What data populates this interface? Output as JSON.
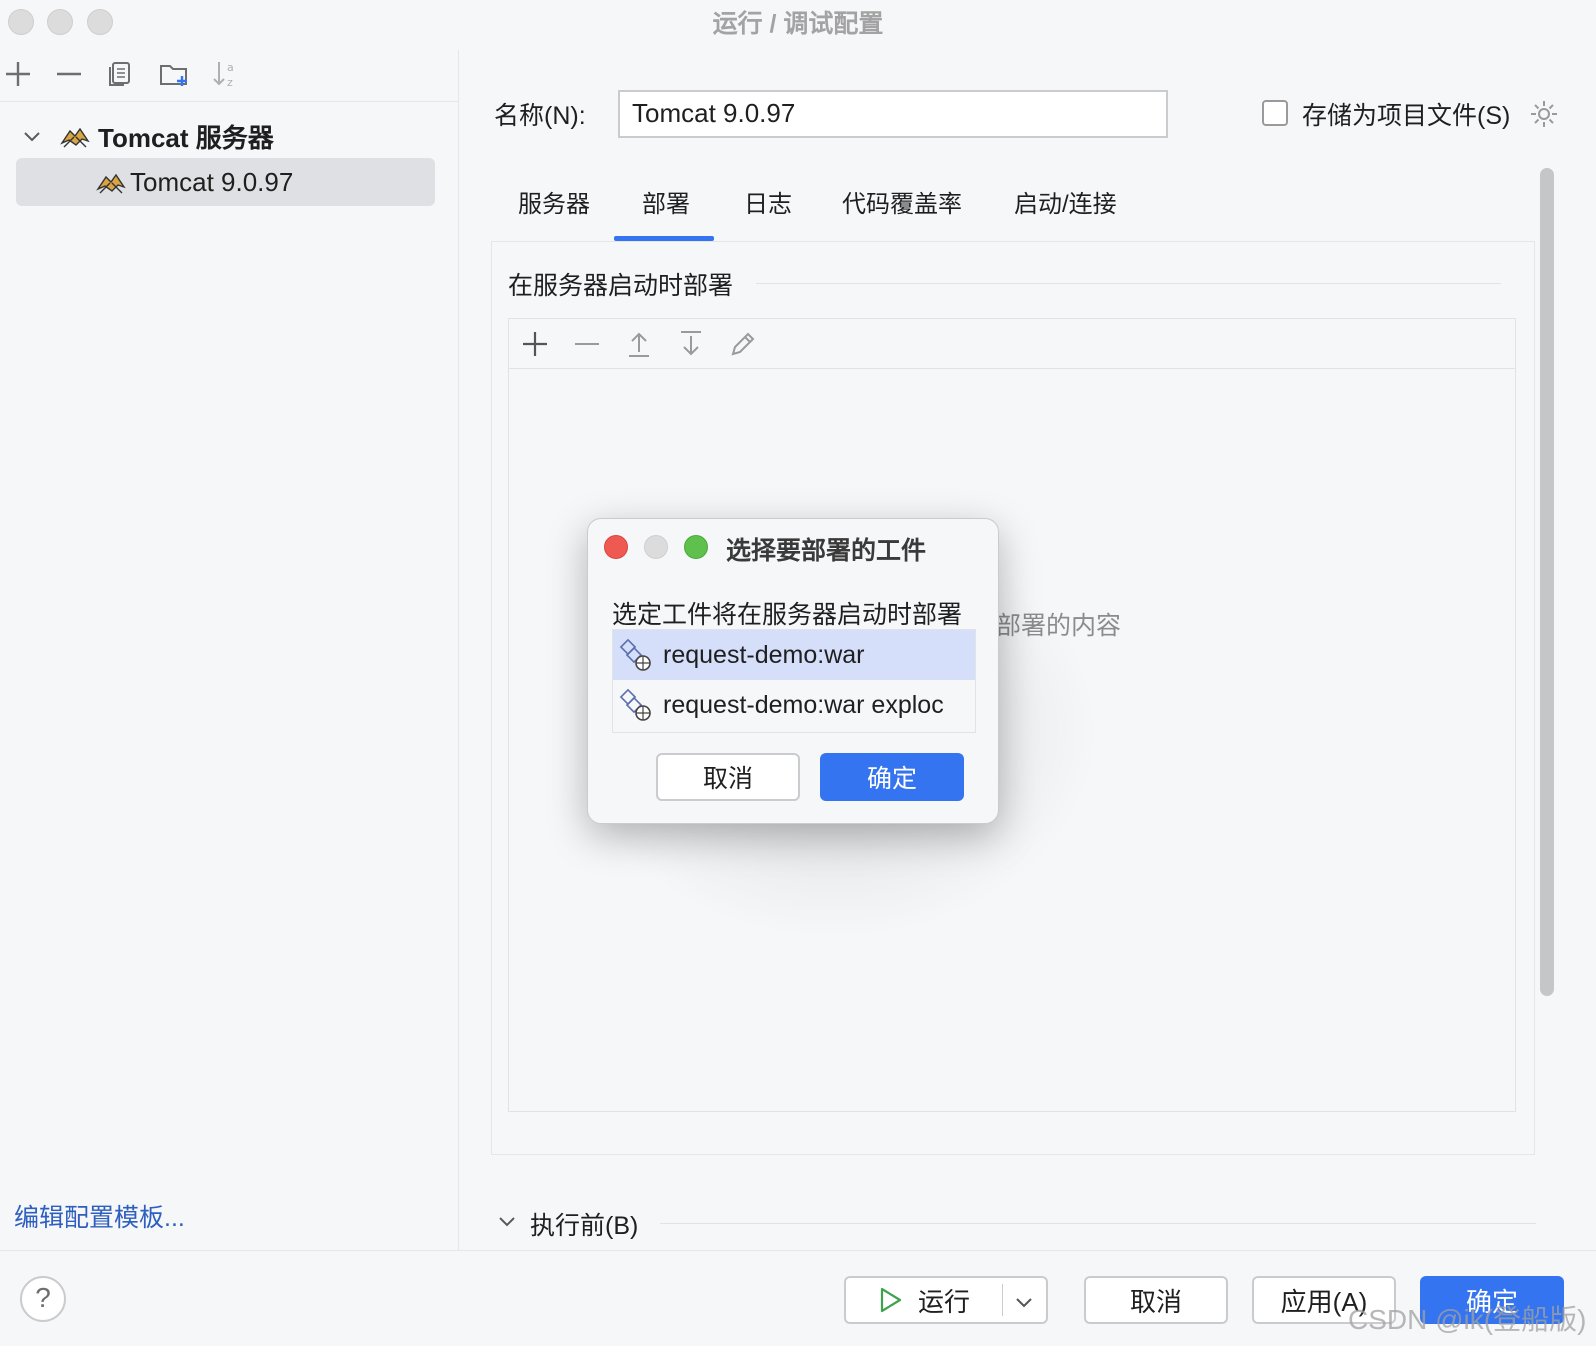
{
  "window": {
    "title": "运行 / 调试配置"
  },
  "left_pane": {
    "group_label": "Tomcat 服务器",
    "item_label": "Tomcat 9.0.97",
    "edit_templates_link": "编辑配置模板..."
  },
  "form": {
    "name_label": "名称(N):",
    "name_value": "Tomcat 9.0.97",
    "store_as_project_label": "存储为项目文件(S)",
    "store_as_project_checked": false
  },
  "tabs": [
    {
      "label": "服务器",
      "active": false
    },
    {
      "label": "部署",
      "active": true
    },
    {
      "label": "日志",
      "active": false
    },
    {
      "label": "代码覆盖率",
      "active": false
    },
    {
      "label": "启动/连接",
      "active": false
    }
  ],
  "deploy": {
    "section_title": "在服务器启动时部署",
    "empty_text_fragment": "部署的内容"
  },
  "before_launch": {
    "label": "执行前(B)"
  },
  "buttons": {
    "run": "运行",
    "cancel": "取消",
    "apply": "应用(A)",
    "ok": "确定"
  },
  "dialog": {
    "title": "选择要部署的工件",
    "message": "选定工件将在服务器启动时部署",
    "artifacts": [
      {
        "label": "request-demo:war",
        "selected": true
      },
      {
        "label": "request-demo:war exploc",
        "selected": false
      }
    ],
    "cancel": "取消",
    "ok": "确定"
  },
  "watermark": "CSDN @ik(登船版)",
  "colors": {
    "accent": "#3574f0",
    "link": "#2e5fbf",
    "selection": "#d5dffa",
    "close": "#ee5a52",
    "zoom": "#5fc04d"
  },
  "icons": [
    "plus-icon",
    "minus-icon",
    "copy-icon",
    "new-folder-icon",
    "sort-icon",
    "tomcat-icon",
    "gear-icon",
    "move-up-icon",
    "move-down-icon",
    "edit-icon",
    "artifact-icon",
    "play-icon",
    "chevron-down-icon",
    "help-icon"
  ]
}
